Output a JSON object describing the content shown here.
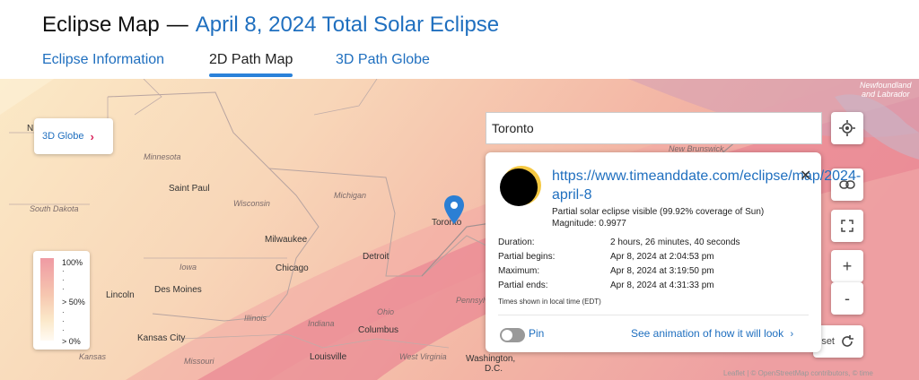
{
  "header": {
    "title": "Eclipse Map",
    "separator": "—",
    "subtitle": "April 8, 2024 Total Solar Eclipse"
  },
  "tabs": [
    {
      "label": "Eclipse Information",
      "active": false
    },
    {
      "label": "2D Path Map",
      "active": true
    },
    {
      "label": "3D Path Globe",
      "active": false
    }
  ],
  "map": {
    "globe_button": "3D Globe",
    "labels": {
      "minnesota": "Minnesota",
      "saint_paul": "Saint Paul",
      "wisconsin": "Wisconsin",
      "michigan": "Michigan",
      "south_dakota": "South Dakota",
      "milwaukee": "Milwaukee",
      "iowa": "Iowa",
      "chicago": "Chicago",
      "detroit": "Detroit",
      "lincoln": "Lincoln",
      "des_moines": "Des Moines",
      "illinois": "Illinois",
      "indiana": "Indiana",
      "ohio": "Ohio",
      "columbus": "Columbus",
      "kansas_city": "Kansas City",
      "kansas": "Kansas",
      "missouri": "Missouri",
      "louisville": "Louisville",
      "west_virginia": "West Virginia",
      "washington": "Washington,",
      "dc": "D.C.",
      "pennsylvania": "Pennsylv",
      "new_brunswick": "New Brunswick",
      "newfoundland": "Newfoundland",
      "and_labrador": "and Labrador",
      "toronto": "Toronto",
      "nd": "N"
    },
    "legend": {
      "top": "100%",
      "mid": "> 50%",
      "bottom": "> 0%"
    },
    "search_value": "Toronto",
    "reset_label": "set",
    "attribution": "Leaflet | © OpenStreetMap contributors, © time"
  },
  "popup": {
    "url": "https://www.timeanddate.com/eclipse/map/2024-april-8",
    "visibility": "Partial solar eclipse visible (99.92% coverage of Sun)",
    "magnitude": "Magnitude: 0.9977",
    "rows": [
      {
        "label": "Duration:",
        "value": "2 hours, 26 minutes, 40 seconds"
      },
      {
        "label": "Partial begins:",
        "value": "Apr 8, 2024 at 2:04:53 pm"
      },
      {
        "label": "Maximum:",
        "value": "Apr 8, 2024 at 3:19:50 pm"
      },
      {
        "label": "Partial ends:",
        "value": "Apr 8, 2024 at 4:31:33 pm"
      }
    ],
    "timezone_note": "Times shown in local time (EDT)",
    "pin_label": "Pin",
    "pin_on": false,
    "animation_link": "See animation of how it will look",
    "close_symbol": "✕"
  }
}
